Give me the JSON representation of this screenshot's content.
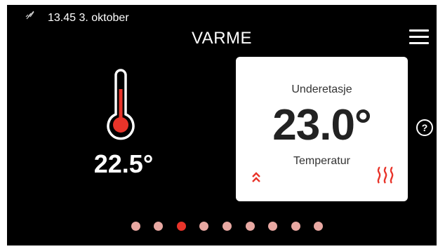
{
  "status": {
    "datetime": "13.45 3. oktober",
    "icon": "no-connection-icon"
  },
  "header": {
    "title": "VARME",
    "menu_icon": "hamburger-menu-icon"
  },
  "current": {
    "temperature": "22.5°",
    "icon": "thermometer-icon"
  },
  "card": {
    "title": "Underetasje",
    "value": "23.0°",
    "label": "Temperatur",
    "left_icon": "double-chevron-up-icon",
    "right_icon": "heating-icon"
  },
  "help": {
    "label": "?"
  },
  "pagination": {
    "count": 9,
    "active_index": 2
  },
  "colors": {
    "accent": "#e8342a",
    "dot_inactive": "#e8a8a2",
    "background": "#000000",
    "card": "#ffffff"
  }
}
